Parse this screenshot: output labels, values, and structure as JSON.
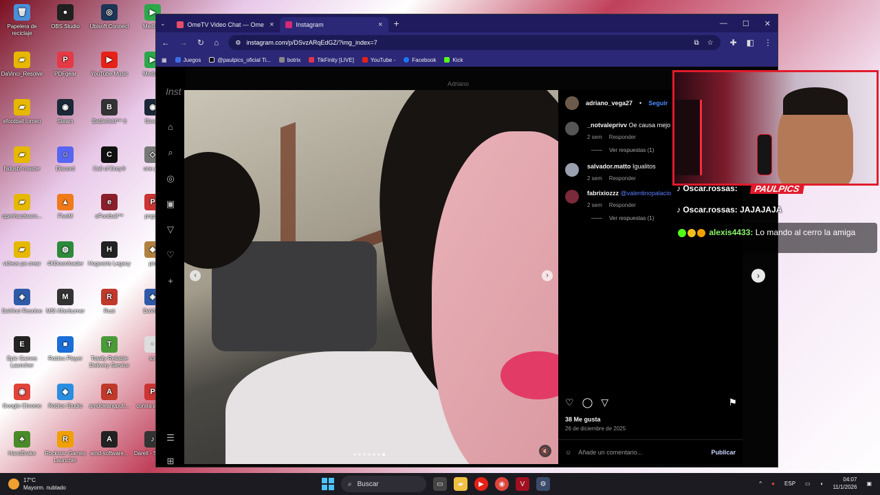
{
  "desktop": {
    "icons": [
      {
        "label": "Papelera de reciclaje",
        "color": "#4a90d9",
        "glyph": "🗑"
      },
      {
        "label": "OBS Studio",
        "color": "#202020",
        "glyph": "●"
      },
      {
        "label": "Ubisoft Connect",
        "color": "#1d3557",
        "glyph": "◎"
      },
      {
        "label": "MediaG",
        "color": "#2aa84a",
        "glyph": "▶"
      },
      {
        "label": "DaVinci_Resolve",
        "color": "#e6b800",
        "glyph": "▰"
      },
      {
        "label": "PDFgear",
        "color": "#e63946",
        "glyph": "P"
      },
      {
        "label": "YouTube Music",
        "color": "#e62117",
        "glyph": "▶"
      },
      {
        "label": "MediaG",
        "color": "#2aa84a",
        "glyph": "▶"
      },
      {
        "label": "efootball torneo",
        "color": "#e6b800",
        "glyph": "▰"
      },
      {
        "label": "Steam",
        "color": "#1b2838",
        "glyph": "◉"
      },
      {
        "label": "Battlefield™ 6",
        "color": "#333",
        "glyph": "B"
      },
      {
        "label": "Steam",
        "color": "#1b2838",
        "glyph": "◉"
      },
      {
        "label": "hidusbf-master",
        "color": "#e6b800",
        "glyph": "▰"
      },
      {
        "label": "Discord",
        "color": "#5865f2",
        "glyph": "☺"
      },
      {
        "label": "Call of Duty®",
        "color": "#111",
        "glyph": "C"
      },
      {
        "label": "one pie",
        "color": "#777",
        "glyph": "◇"
      },
      {
        "label": "openhardware...",
        "color": "#e6b800",
        "glyph": "▰"
      },
      {
        "label": "FiveM",
        "color": "#f07a1a",
        "glyph": "▲"
      },
      {
        "label": "eFootball™",
        "color": "#8a1f2a",
        "glyph": "e"
      },
      {
        "label": "pngtre",
        "color": "#c33",
        "glyph": "P"
      },
      {
        "label": "videos pa crear",
        "color": "#e6b800",
        "glyph": "▰"
      },
      {
        "label": "4KDownloader",
        "color": "#2c8a3a",
        "glyph": "◍"
      },
      {
        "label": "Hogwarts Legacy",
        "color": "#222",
        "glyph": "H"
      },
      {
        "label": "pin",
        "color": "#b08040",
        "glyph": "◆"
      },
      {
        "label": "DaVinci Resolve",
        "color": "#2e5aa8",
        "glyph": "◈"
      },
      {
        "label": "MSI Afterburner",
        "color": "#333",
        "glyph": "M"
      },
      {
        "label": "Rust",
        "color": "#c0392b",
        "glyph": "R"
      },
      {
        "label": "DaVinci",
        "color": "#2e5aa8",
        "glyph": "◈"
      },
      {
        "label": "Epic Games Launcher",
        "color": "#222",
        "glyph": "E"
      },
      {
        "label": "Roblox Player",
        "color": "#1a6ed8",
        "glyph": "■"
      },
      {
        "label": "Totally Reliable Delivery Service",
        "color": "#4a9a3a",
        "glyph": "T"
      },
      {
        "label": "tor",
        "color": "#ddd",
        "glyph": "·"
      },
      {
        "label": "Google Chrome",
        "color": "#e0443a",
        "glyph": "◉"
      },
      {
        "label": "Roblox Studio",
        "color": "#2a8ee0",
        "glyph": "◆"
      },
      {
        "label": "amdcleanuputi...",
        "color": "#c0392b",
        "glyph": "A"
      },
      {
        "label": "contra alquile",
        "color": "#c33",
        "glyph": "P"
      },
      {
        "label": "HandBrake",
        "color": "#4a8a2a",
        "glyph": "♣"
      },
      {
        "label": "Rockstar Games Launcher",
        "color": "#f0a000",
        "glyph": "R"
      },
      {
        "label": "amd-software...",
        "color": "#222",
        "glyph": "A"
      },
      {
        "label": "Darell - Solo (A",
        "color": "#333",
        "glyph": "♪"
      }
    ]
  },
  "browser": {
    "tabs": [
      {
        "label": "OmeTV Video Chat — Ome",
        "active": false,
        "fav_color": "#e74c6a"
      },
      {
        "label": "Instagram",
        "active": true,
        "fav_color": "#d62976"
      }
    ],
    "url": "instagram.com/p/DSvzARqEdGZ/?img_index=7",
    "bookmarks": [
      {
        "label": "Juegos",
        "color": "#3a6ee8"
      },
      {
        "label": "@paulpics_oficial Ti...",
        "color": "#111"
      },
      {
        "label": "botrix",
        "color": "#888"
      },
      {
        "label": "TikFinity [LIVE]",
        "color": "#e0334a"
      },
      {
        "label": "YouTube -",
        "color": "#e62117"
      },
      {
        "label": "Facebook",
        "color": "#1877f2"
      },
      {
        "label": "Kick",
        "color": "#53fc18"
      }
    ]
  },
  "instagram": {
    "logo_text": "Inst",
    "above_name": "Adriano",
    "post": {
      "author": "adriano_vega27",
      "follow_label": "Seguir",
      "comments": [
        {
          "user": "_notvaleprivv",
          "text": "Oe causa mejo",
          "time": "2 sem",
          "reply": "Responder",
          "replies_label": "Ver respuestas (1)",
          "avatar": "#555"
        },
        {
          "user": "salvador.matto",
          "text": "Igualitos",
          "time": "2 sem",
          "reply": "Responder",
          "replies_label": "",
          "avatar": "#9aa0b0"
        },
        {
          "user": "fabrixiozzz",
          "mention": "@valentinopalacio",
          "text": "",
          "time": "2 sem",
          "reply": "Responder",
          "replies_label": "Ver respuestas (1)",
          "avatar": "#7a2a3a"
        }
      ],
      "likes": "38 Me gusta",
      "date": "26 de diciembre de 2025",
      "add_comment_placeholder": "Añade un comentario...",
      "publish_label": "Publicar",
      "carousel_total": 7,
      "carousel_index": 7
    }
  },
  "stream_overlay": {
    "brand": "PAULPICS",
    "chat": [
      {
        "text": "Oscar.rossas:"
      },
      {
        "text": "Oscar.rossas: JAJAJAJA"
      }
    ],
    "highlight": {
      "name": "alexis4433:",
      "message": "Lo mando al cerro la amiga"
    }
  },
  "taskbar": {
    "temperature": "17°C",
    "weather": "Mayorm. nublado",
    "search_label": "Buscar",
    "language": "ESP",
    "time": "04:07",
    "date": "11/1/2026"
  }
}
